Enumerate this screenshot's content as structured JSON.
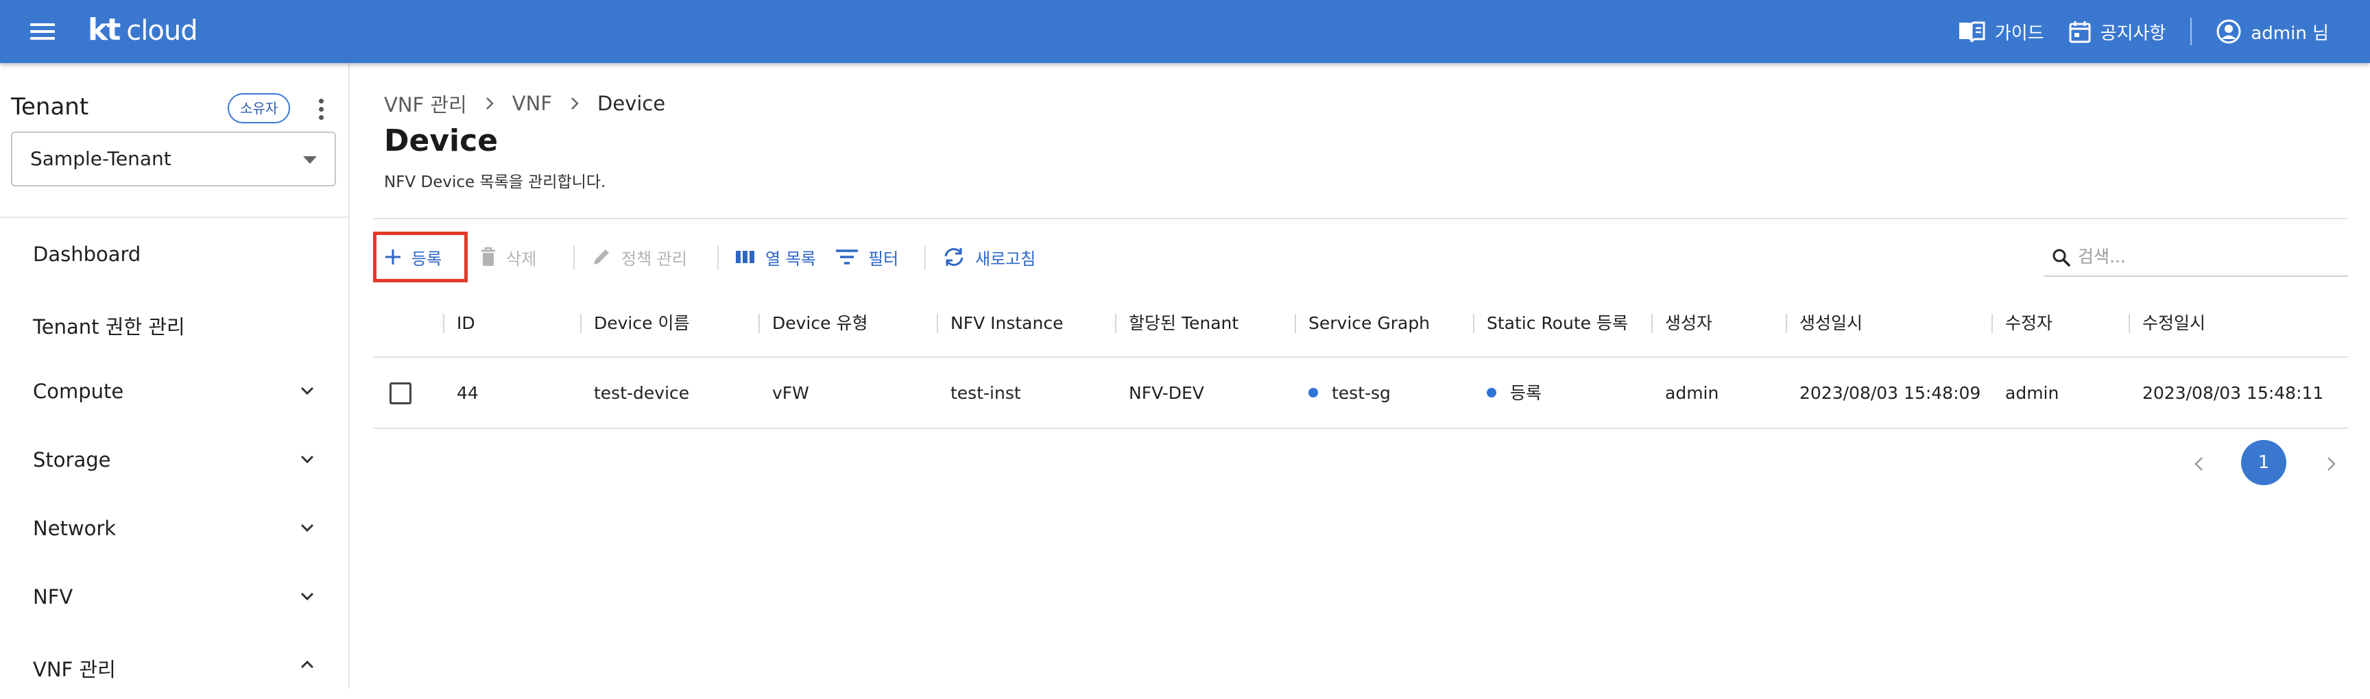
{
  "header": {
    "logo_kt": "kt",
    "logo_cloud": "cloud",
    "guide_label": "가이드",
    "notice_label": "공지사항",
    "user_label": "admin 님",
    "bar_color": "#3a78d0"
  },
  "sidebar": {
    "tenant_title": "Tenant",
    "owner_badge": "소유자",
    "tenant_selected": "Sample-Tenant",
    "items": [
      {
        "label": "Dashboard",
        "expandable": false
      },
      {
        "label": "Tenant 권한 관리",
        "expandable": false
      },
      {
        "label": "Compute",
        "expandable": true,
        "expanded": false
      },
      {
        "label": "Storage",
        "expandable": true,
        "expanded": false
      },
      {
        "label": "Network",
        "expandable": true,
        "expanded": false
      },
      {
        "label": "NFV",
        "expandable": true,
        "expanded": false
      },
      {
        "label": "VNF 관리",
        "expandable": true,
        "expanded": true
      }
    ]
  },
  "breadcrumb": [
    "VNF 관리",
    "VNF",
    "Device"
  ],
  "page": {
    "title": "Device",
    "description": "NFV Device 목록을 관리합니다."
  },
  "toolbar": {
    "register": "등록",
    "delete": "삭제",
    "policy": "정책 관리",
    "columns": "열 목록",
    "filter": "필터",
    "refresh": "새로고침",
    "search_placeholder": "검색..."
  },
  "table": {
    "columns": [
      "ID",
      "Device 이름",
      "Device 유형",
      "NFV Instance",
      "할당된 Tenant",
      "Service Graph",
      "Static Route 등록",
      "생성자",
      "생성일시",
      "수정자",
      "수정일시"
    ],
    "rows": [
      {
        "id": "44",
        "device_name": "test-device",
        "device_type": "vFW",
        "nfv_instance": "test-inst",
        "tenant": "NFV-DEV",
        "service_graph": "test-sg",
        "static_route": "등록",
        "creator": "admin",
        "created_at": "2023/08/03 15:48:09",
        "modifier": "admin",
        "modified_at": "2023/08/03 15:48:11"
      }
    ]
  },
  "pagination": {
    "current_page": "1"
  },
  "colors": {
    "accent": "#3a78d0",
    "highlight_border": "#e03a2a",
    "status_dot": "#2e73d6"
  }
}
